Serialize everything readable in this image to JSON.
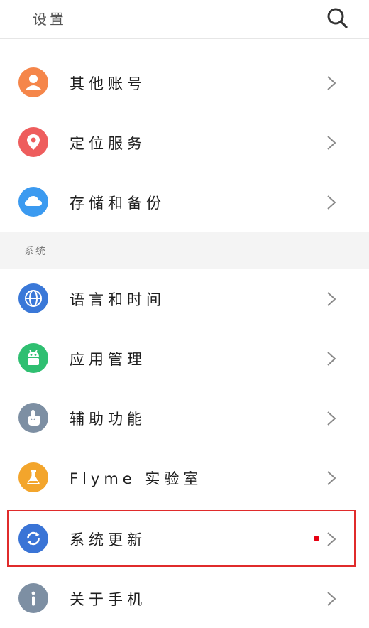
{
  "header": {
    "title": "设置"
  },
  "items_top": [
    {
      "label": "其他账号",
      "icon": "account-icon",
      "color": "#f5864a"
    },
    {
      "label": "定位服务",
      "icon": "location-icon",
      "color": "#ee5d5d"
    },
    {
      "label": "存储和备份",
      "icon": "cloud-icon",
      "color": "#3b9af0"
    }
  ],
  "section": {
    "label": "系统"
  },
  "items_system": [
    {
      "label": "语言和时间",
      "icon": "globe-icon",
      "color": "#3a78d8"
    },
    {
      "label": "应用管理",
      "icon": "android-icon",
      "color": "#2fbf71"
    },
    {
      "label": "辅助功能",
      "icon": "hand-icon",
      "color": "#7d8fa3"
    },
    {
      "label": "Flyme 实验室",
      "icon": "flask-icon",
      "color": "#f3a52c"
    },
    {
      "label": "系统更新",
      "icon": "refresh-icon",
      "color": "#3a74d6",
      "badge": true
    },
    {
      "label": "关于手机",
      "icon": "info-icon",
      "color": "#7d8fa3"
    }
  ],
  "colors": {
    "highlight": "#e02b2b",
    "badge": "#e60012"
  }
}
